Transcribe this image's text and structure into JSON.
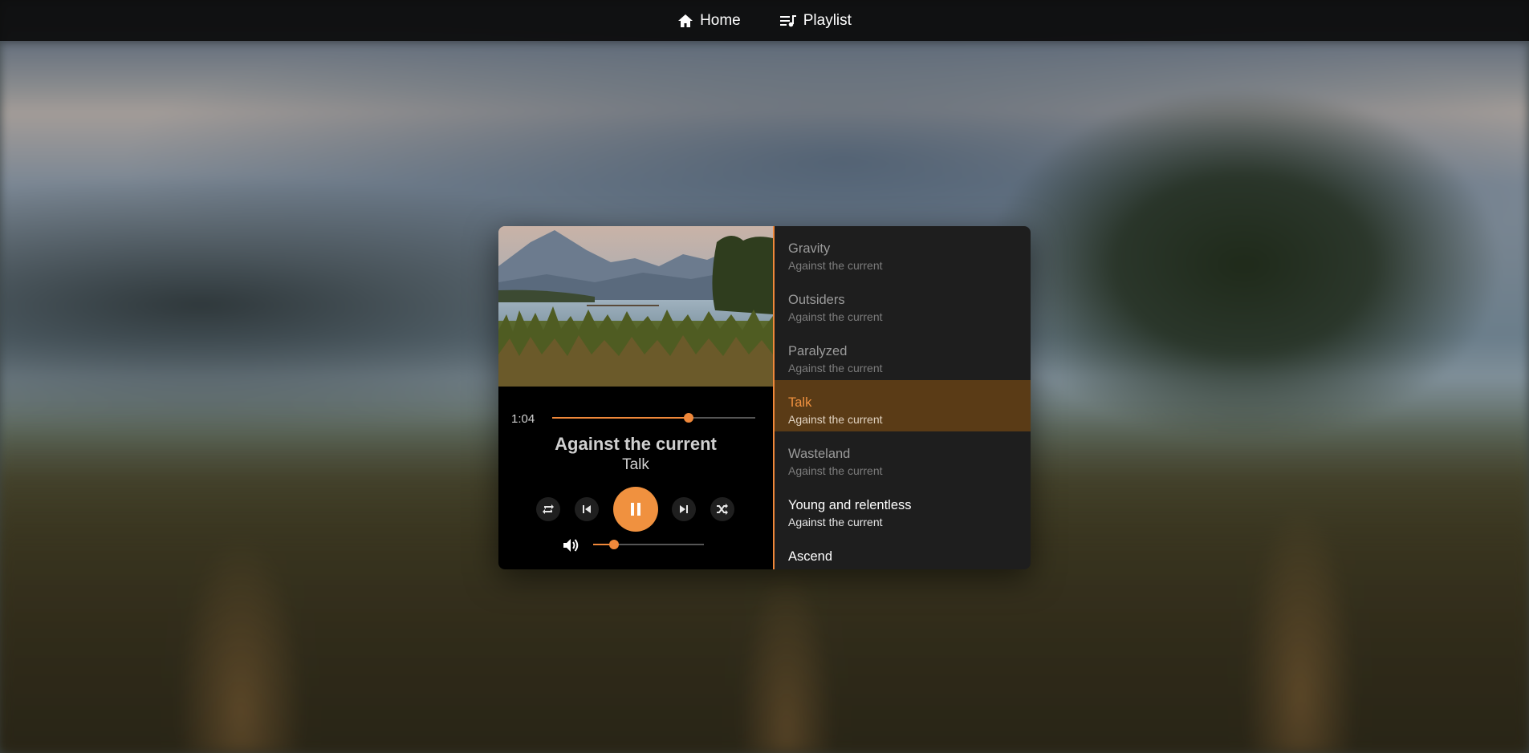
{
  "nav": {
    "home_label": "Home",
    "playlist_label": "Playlist",
    "home_icon": "home-icon",
    "playlist_icon": "playlist-icon"
  },
  "player": {
    "current_time": "1:04",
    "progress": 0.67,
    "volume": 0.19,
    "artist": "Against the current",
    "song": "Talk",
    "controls": [
      "repeat-icon",
      "previous-icon",
      "pause-icon",
      "next-icon",
      "shuffle-icon",
      "volume-icon"
    ],
    "accent_color": "#f0913f"
  },
  "playlist": {
    "items": [
      {
        "title": "Gravity",
        "artist": "Against the current",
        "state": "played"
      },
      {
        "title": "Outsiders",
        "artist": "Against the current",
        "state": "played"
      },
      {
        "title": "Paralyzed",
        "artist": "Against the current",
        "state": "played"
      },
      {
        "title": "Talk",
        "artist": "Against the current",
        "state": "active"
      },
      {
        "title": "Wasteland",
        "artist": "Against the current",
        "state": "played"
      },
      {
        "title": "Young and relentless",
        "artist": "Against the current",
        "state": "upcoming"
      },
      {
        "title": "Ascend",
        "artist": "",
        "state": "upcoming"
      }
    ]
  }
}
